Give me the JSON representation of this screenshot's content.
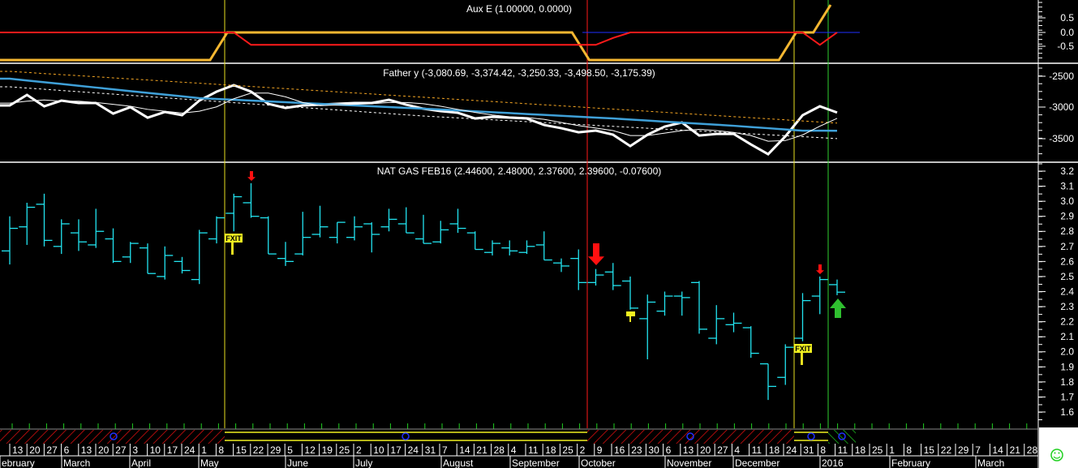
{
  "panels": {
    "aux": {
      "title": "Aux E (1.00000, 0.0000)",
      "ticks": [
        "0.5",
        "0.0",
        "-0.5"
      ]
    },
    "father": {
      "title": "Father y (-3,080.69, -3,374.42, -3,250.33, -3,498.50, -3,175.39)",
      "ticks": [
        "-2500",
        "-3000",
        "-3500"
      ]
    },
    "price": {
      "title": "NAT GAS FEB16 (2.44600, 2.48000, 2.37600, 2.39600, -0.07600)",
      "ticks": [
        "3.2",
        "3.1",
        "3.0",
        "2.9",
        "2.8",
        "2.7",
        "2.6",
        "2.5",
        "2.4",
        "2.3",
        "2.2",
        "2.1",
        "2.0",
        "1.9",
        "1.8",
        "1.7",
        "1.6"
      ]
    }
  },
  "markers": {
    "exit_label": "FXIT",
    "exit_label_2": "FXIT"
  },
  "status_icon": "smiley-icon",
  "colors": {
    "bars": "#22e4f0",
    "aux_orange": "#f5b731",
    "aux_red": "#ff1a1a",
    "father_blue": "#3fa0d8",
    "band_orange": "#f5a623",
    "up_arrow": "#2fbf2f",
    "down_arrow": "#ff1010"
  },
  "chart_data": [
    {
      "type": "line",
      "title": "Aux E (1.00000, 0.0000)",
      "ylim": [
        -1.1,
        1.1
      ],
      "series": [
        {
          "color": "#f5b731",
          "values": [
            -1,
            -1,
            -1,
            -1,
            -1,
            -1,
            -1,
            -1,
            -1,
            -1,
            -1,
            -1,
            -1,
            0,
            0,
            0,
            0,
            0,
            0,
            0,
            0,
            0,
            0,
            0,
            0,
            0,
            0,
            0,
            0,
            0,
            0,
            0,
            0,
            0,
            -1,
            -1,
            -1,
            -1,
            -1,
            -1,
            -1,
            -1,
            -1,
            -1,
            -1,
            -1,
            0,
            0,
            1
          ]
        },
        {
          "color": "#ff1a1a",
          "values": [
            0,
            0,
            0,
            0,
            0,
            0,
            0,
            0,
            0,
            0,
            0,
            0,
            0,
            0,
            -0.45,
            -0.45,
            -0.45,
            -0.45,
            -0.45,
            -0.45,
            -0.45,
            -0.45,
            -0.45,
            -0.45,
            -0.45,
            -0.45,
            -0.45,
            -0.45,
            -0.45,
            -0.45,
            -0.45,
            -0.45,
            -0.45,
            -0.45,
            -0.45,
            -0.2,
            0,
            0,
            0,
            0,
            0,
            0,
            0,
            0,
            0,
            0,
            0,
            -0.45,
            0
          ]
        }
      ]
    },
    {
      "type": "line",
      "title": "Father y (-3,080.69, -3,374.42, -3,250.33, -3,498.50, -3,175.39)",
      "ylim": [
        -3900,
        -2300
      ],
      "series": [
        {
          "color": "#ffffff",
          "style": "thick",
          "values": [
            -2968,
            -2799,
            -2981,
            -2890,
            -2929,
            -2929,
            -3098,
            -2994,
            -3163,
            -3072,
            -3124,
            -2890,
            -2747,
            -2643,
            -2747,
            -2942,
            -3007,
            -2968,
            -2955,
            -2942,
            -2929,
            -2929,
            -2877,
            -2955,
            -3020,
            -3059,
            -3085,
            -3176,
            -3150,
            -3163,
            -3176,
            -3280,
            -3332,
            -3397,
            -3371,
            -3436,
            -3618,
            -3436,
            -3306,
            -3241,
            -3449,
            -3423,
            -3423,
            -3592,
            -3748,
            -3462,
            -3124,
            -2981,
            -3081
          ]
        },
        {
          "color": "#3fa0d8",
          "values": [
            -2539,
            -2568,
            -2596,
            -2624,
            -2652,
            -2681,
            -2709,
            -2738,
            -2766,
            -2794,
            -2822,
            -2851,
            -2864,
            -2877,
            -2890,
            -2903,
            -2916,
            -2929,
            -2942,
            -2955,
            -2968,
            -2981,
            -2994,
            -3007,
            -3020,
            -3033,
            -3047,
            -3062,
            -3076,
            -3090,
            -3105,
            -3119,
            -3133,
            -3147,
            -3162,
            -3176,
            -3193,
            -3210,
            -3227,
            -3243,
            -3259,
            -3276,
            -3293,
            -3313,
            -3332,
            -3352,
            -3371,
            -3371,
            -3374
          ]
        },
        {
          "color": "#f5a623",
          "style": "dashed",
          "values": [
            -2422,
            -2439,
            -2457,
            -2474,
            -2491,
            -2508,
            -2526,
            -2543,
            -2560,
            -2577,
            -2595,
            -2612,
            -2629,
            -2646,
            -2664,
            -2681,
            -2698,
            -2715,
            -2733,
            -2750,
            -2767,
            -2784,
            -2802,
            -2819,
            -2836,
            -2853,
            -2871,
            -2888,
            -2905,
            -2922,
            -2940,
            -2957,
            -2974,
            -2991,
            -3009,
            -3026,
            -3043,
            -3060,
            -3078,
            -3095,
            -3112,
            -3129,
            -3147,
            -3164,
            -3181,
            -3198,
            -3216,
            -3233,
            -3250
          ]
        },
        {
          "color": "#ffffff",
          "style": "dashed",
          "values": [
            -2669,
            -2689,
            -2708,
            -2728,
            -2747,
            -2767,
            -2786,
            -2806,
            -2825,
            -2845,
            -2864,
            -2884,
            -2903,
            -2923,
            -2942,
            -2962,
            -2981,
            -3001,
            -3020,
            -3040,
            -3059,
            -3079,
            -3098,
            -3118,
            -3137,
            -3152,
            -3167,
            -3182,
            -3197,
            -3212,
            -3227,
            -3242,
            -3257,
            -3272,
            -3287,
            -3302,
            -3317,
            -3332,
            -3347,
            -3362,
            -3377,
            -3392,
            -3407,
            -3422,
            -3437,
            -3452,
            -3467,
            -3483,
            -3498
          ]
        },
        {
          "color": "#ffffff",
          "style": "thin",
          "values": [
            -2930,
            -2900,
            -2880,
            -2900,
            -2900,
            -2920,
            -2950,
            -2980,
            -3030,
            -3060,
            -3090,
            -3060,
            -2990,
            -2860,
            -2770,
            -2770,
            -2830,
            -2920,
            -2970,
            -2960,
            -2950,
            -2940,
            -2920,
            -2920,
            -2940,
            -2980,
            -3030,
            -3080,
            -3120,
            -3150,
            -3160,
            -3190,
            -3240,
            -3290,
            -3330,
            -3370,
            -3450,
            -3450,
            -3410,
            -3370,
            -3350,
            -3370,
            -3400,
            -3450,
            -3540,
            -3530,
            -3440,
            -3300,
            -3175
          ]
        }
      ]
    },
    {
      "type": "ohlc",
      "title": "NAT GAS FEB16 (2.44600, 2.48000, 2.37600, 2.39600, -0.07600)",
      "ylim": [
        1.55,
        3.25
      ],
      "ohlc": [
        [
          2.67,
          2.9,
          2.58,
          2.82
        ],
        [
          2.83,
          2.99,
          2.71,
          2.96
        ],
        [
          2.98,
          3.05,
          2.7,
          2.74
        ],
        [
          2.7,
          2.88,
          2.65,
          2.85
        ],
        [
          2.79,
          2.88,
          2.67,
          2.73
        ],
        [
          2.71,
          2.95,
          2.69,
          2.8
        ],
        [
          2.75,
          2.82,
          2.59,
          2.6
        ],
        [
          2.63,
          2.73,
          2.59,
          2.72
        ],
        [
          2.69,
          2.72,
          2.52,
          2.52
        ],
        [
          2.5,
          2.7,
          2.48,
          2.64
        ],
        [
          2.6,
          2.63,
          2.52,
          2.54
        ],
        [
          2.48,
          2.81,
          2.45,
          2.79
        ],
        [
          2.75,
          2.9,
          2.72,
          2.89
        ],
        [
          2.92,
          3.05,
          2.8,
          3.03
        ],
        [
          2.99,
          3.12,
          2.89,
          2.9
        ],
        [
          2.89,
          2.9,
          2.65,
          2.65
        ],
        [
          2.62,
          2.73,
          2.57,
          2.6
        ],
        [
          2.65,
          2.93,
          2.64,
          2.76
        ],
        [
          2.78,
          2.97,
          2.76,
          2.83
        ],
        [
          2.76,
          2.86,
          2.72,
          2.86
        ],
        [
          2.76,
          2.9,
          2.74,
          2.83
        ],
        [
          2.85,
          2.86,
          2.66,
          2.78
        ],
        [
          2.83,
          2.95,
          2.8,
          2.88
        ],
        [
          2.85,
          2.96,
          2.79,
          2.79
        ],
        [
          2.75,
          2.91,
          2.72,
          2.72
        ],
        [
          2.73,
          2.87,
          2.72,
          2.81
        ],
        [
          2.85,
          2.95,
          2.79,
          2.82
        ],
        [
          2.79,
          2.8,
          2.68,
          2.68
        ],
        [
          2.66,
          2.74,
          2.64,
          2.72
        ],
        [
          2.69,
          2.74,
          2.64,
          2.67
        ],
        [
          2.66,
          2.74,
          2.65,
          2.7
        ],
        [
          2.71,
          2.8,
          2.61,
          2.61
        ],
        [
          2.59,
          2.62,
          2.53,
          2.57
        ],
        [
          2.62,
          2.68,
          2.41,
          2.46
        ],
        [
          2.46,
          2.55,
          2.44,
          2.51
        ],
        [
          2.53,
          2.59,
          2.41,
          2.44
        ],
        [
          2.47,
          2.5,
          2.28,
          2.29
        ],
        [
          2.22,
          2.38,
          1.95,
          2.33
        ],
        [
          2.27,
          2.4,
          2.24,
          2.37
        ],
        [
          2.37,
          2.4,
          2.24,
          2.36
        ],
        [
          2.46,
          2.47,
          2.12,
          2.15
        ],
        [
          2.09,
          2.31,
          2.05,
          2.22
        ],
        [
          2.18,
          2.26,
          2.13,
          2.19
        ],
        [
          2.16,
          2.17,
          1.96,
          1.99
        ],
        [
          1.92,
          1.92,
          1.68,
          1.77
        ],
        [
          1.83,
          2.05,
          1.78,
          2.03
        ],
        [
          2.09,
          2.39,
          2.07,
          2.34
        ],
        [
          2.37,
          2.5,
          2.25,
          2.48
        ],
        [
          2.446,
          2.48,
          2.376,
          2.396
        ]
      ]
    }
  ],
  "x_axis": {
    "days": [
      "13",
      "20",
      "27",
      "6",
      "13",
      "20",
      "27",
      "3",
      "10",
      "17",
      "24",
      "1",
      "8",
      "15",
      "22",
      "29",
      "5",
      "12",
      "19",
      "25",
      "2",
      "10",
      "17",
      "24",
      "31",
      "7",
      "14",
      "21",
      "28",
      "4",
      "11",
      "18",
      "25",
      "2",
      "9",
      "16",
      "23",
      "30",
      "6",
      "13",
      "20",
      "27",
      "4",
      "11",
      "18",
      "24",
      "31",
      "8",
      "11",
      "18",
      "25",
      "1",
      "8",
      "15",
      "22",
      "29",
      "7",
      "14",
      "21",
      "28"
    ],
    "months": [
      "ebruary",
      "March",
      "April",
      "May",
      "June",
      "July",
      "August",
      "September",
      "October",
      "November",
      "December",
      "2016",
      "February",
      "March"
    ]
  }
}
